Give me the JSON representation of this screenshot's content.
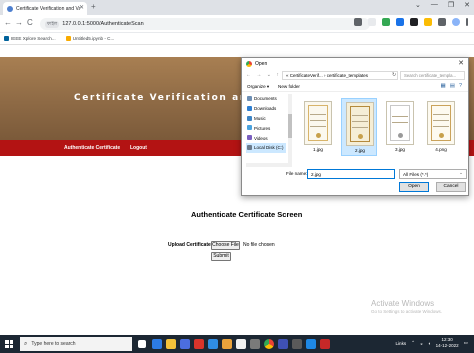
{
  "browser": {
    "tab_title": "Certificate Verification and Vali...",
    "tab_close": "✕",
    "new_tab": "+",
    "window_buttons": [
      "⌄",
      "—",
      "❐",
      "✕"
    ],
    "back": "←",
    "forward": "→",
    "reload": "C",
    "omnibox_label": "ফাইল",
    "url": "127.0.0.1:5000/AuthenticateScan",
    "bookmarks": [
      {
        "label": "IEEE Xplore Search...",
        "icon": "ieee-icon",
        "color": "#00629b"
      },
      {
        "label": "Untitled5.ipynb - C...",
        "icon": "colab-icon",
        "color": "#f9ab00"
      }
    ]
  },
  "page": {
    "banner_title": "Certificate Verification and Valida",
    "nav_links": [
      "Authenticate Certificate",
      "Logout"
    ],
    "heading": "Authenticate Certificate Screen",
    "upload_label": "Upload Certificate",
    "choose_file": "Choose File",
    "file_status": "No file chosen",
    "submit": "Submit",
    "banner_color": "#8e6a45",
    "nav_color": "#b31313"
  },
  "dialog": {
    "title": "Open",
    "close": "✕",
    "nav_arrows": "← → ⌄ ↑",
    "path": "« CertificateVerif... › certificate_templates",
    "refresh": "↻",
    "search_placeholder": "Search certificate_templa...",
    "organize": "Organize ▾",
    "new_folder": "New folder",
    "view_icons": [
      "▦",
      "▤",
      "?"
    ],
    "nav_items": [
      "Documents",
      "Downloads",
      "Music",
      "Pictures",
      "Videos",
      "Local Disk (C:)"
    ],
    "files": [
      "1.jpg",
      "2.jpg",
      "3.jpg",
      "4.png"
    ],
    "file_name_label": "File name:",
    "file_name_value": "2.jpg",
    "file_type": "All Files (*.*)",
    "open_button": "Open",
    "cancel_button": "Cancel"
  },
  "watermark": {
    "title": "Activate Windows",
    "subtitle": "Go to Settings to activate Windows."
  },
  "taskbar": {
    "search_placeholder": "Type here to search",
    "links_label": "Links",
    "time": "12:30",
    "date": "14-12-2022"
  }
}
